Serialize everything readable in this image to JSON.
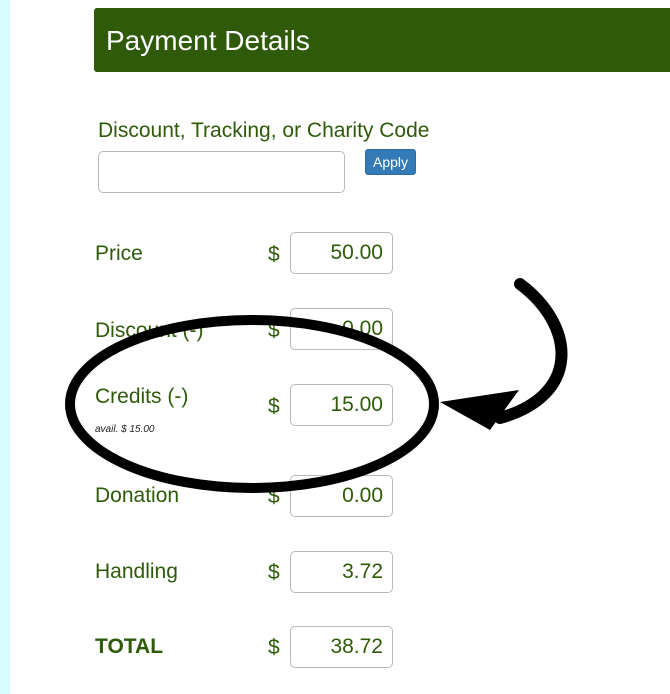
{
  "header": {
    "title": "Payment Details"
  },
  "code": {
    "label": "Discount, Tracking, or Charity Code",
    "value": "",
    "placeholder": "",
    "apply_label": "Apply"
  },
  "rows": [
    {
      "label": "Price",
      "currency": "$",
      "amount": "50.00"
    },
    {
      "label": "Discount (-)",
      "currency": "$",
      "amount": "0.00"
    },
    {
      "label": "Credits (-)",
      "currency": "$",
      "amount": "15.00",
      "note": "avail. $ 15.00"
    },
    {
      "label": "Donation",
      "currency": "$",
      "amount": "0.00"
    },
    {
      "label": "Handling",
      "currency": "$",
      "amount": "3.72"
    },
    {
      "label": "TOTAL",
      "currency": "$",
      "amount": "38.72"
    }
  ],
  "annotation": {
    "shape": "ellipse-circle",
    "arrow": "curved-arrow",
    "color": "#000000"
  },
  "colors": {
    "header_bg": "#2e5a09",
    "text_green": "#2e5a09",
    "apply_bg": "#337ab7",
    "page_bg": "#d7fbff"
  }
}
